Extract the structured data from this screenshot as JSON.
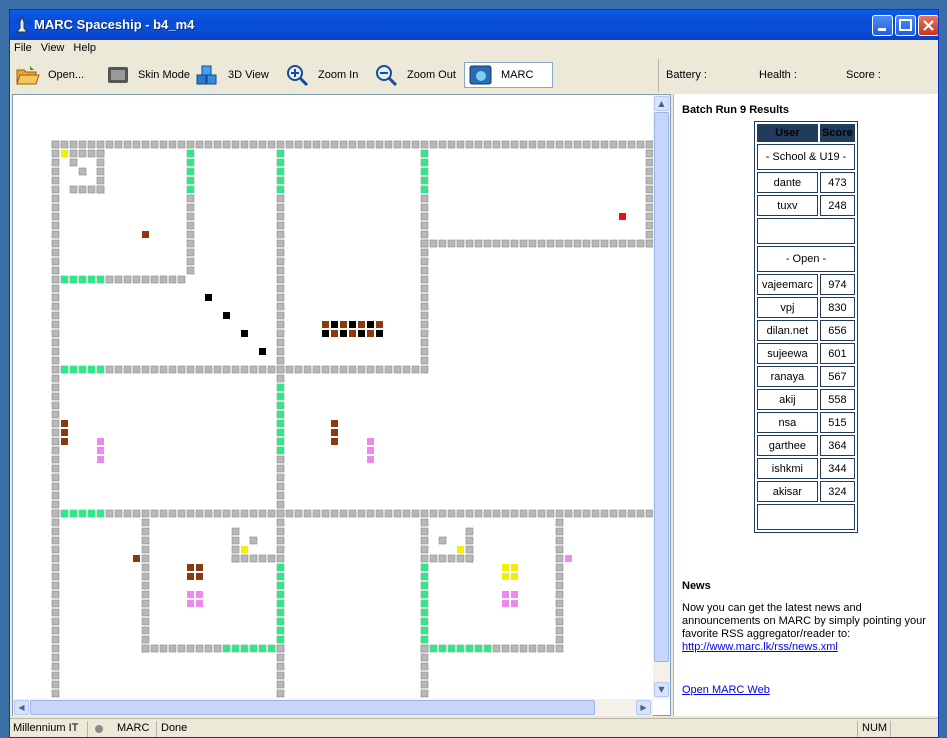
{
  "window": {
    "title": "MARC Spaceship - b4_m4"
  },
  "menu": {
    "file": "File",
    "view": "View",
    "help": "Help"
  },
  "toolbar": {
    "open": "Open...",
    "skin_mode": "Skin Mode",
    "view_3d": "3D View",
    "zoom_in": "Zoom In",
    "zoom_out": "Zoom Out",
    "marc": "MARC"
  },
  "status_panel": {
    "battery": "Battery :",
    "health": "Health :",
    "score": "Score :"
  },
  "results": {
    "title": "Batch Run 9 Results",
    "columns": [
      "User",
      "Score"
    ],
    "group1": "- School & U19 -",
    "school_rows": [
      {
        "user": "dante",
        "score": "473"
      },
      {
        "user": "tuxv",
        "score": "248"
      }
    ],
    "group2": "- Open -",
    "open_rows": [
      {
        "user": "vajeemarc",
        "score": "974"
      },
      {
        "user": "vpj",
        "score": "830"
      },
      {
        "user": "dilan.net",
        "score": "656"
      },
      {
        "user": "sujeewa",
        "score": "601"
      },
      {
        "user": "ranaya",
        "score": "567"
      },
      {
        "user": "akij",
        "score": "558"
      },
      {
        "user": "nsa",
        "score": "515"
      },
      {
        "user": "garthee",
        "score": "364"
      },
      {
        "user": "ishkmi",
        "score": "344"
      },
      {
        "user": "akisar",
        "score": "324"
      }
    ]
  },
  "news": {
    "heading": "News",
    "body": "Now you can get the latest news and announcements on MARC by simply pointing your favorite RSS aggregator/reader to:",
    "link": "http://www.marc.lk/rss/news.xml",
    "open_web": "Open MARC Web"
  },
  "statusbar": {
    "company": "Millennium IT",
    "app": "MARC",
    "state": "Done",
    "num": "NUM"
  },
  "colors": {
    "wall": "#b8b8b8",
    "green_wall": "#2ee88a",
    "brown": "#8b3a10",
    "pink": "#ee88ee",
    "yellow": "#f0f000",
    "black": "#000000",
    "red": "#ee1111"
  }
}
